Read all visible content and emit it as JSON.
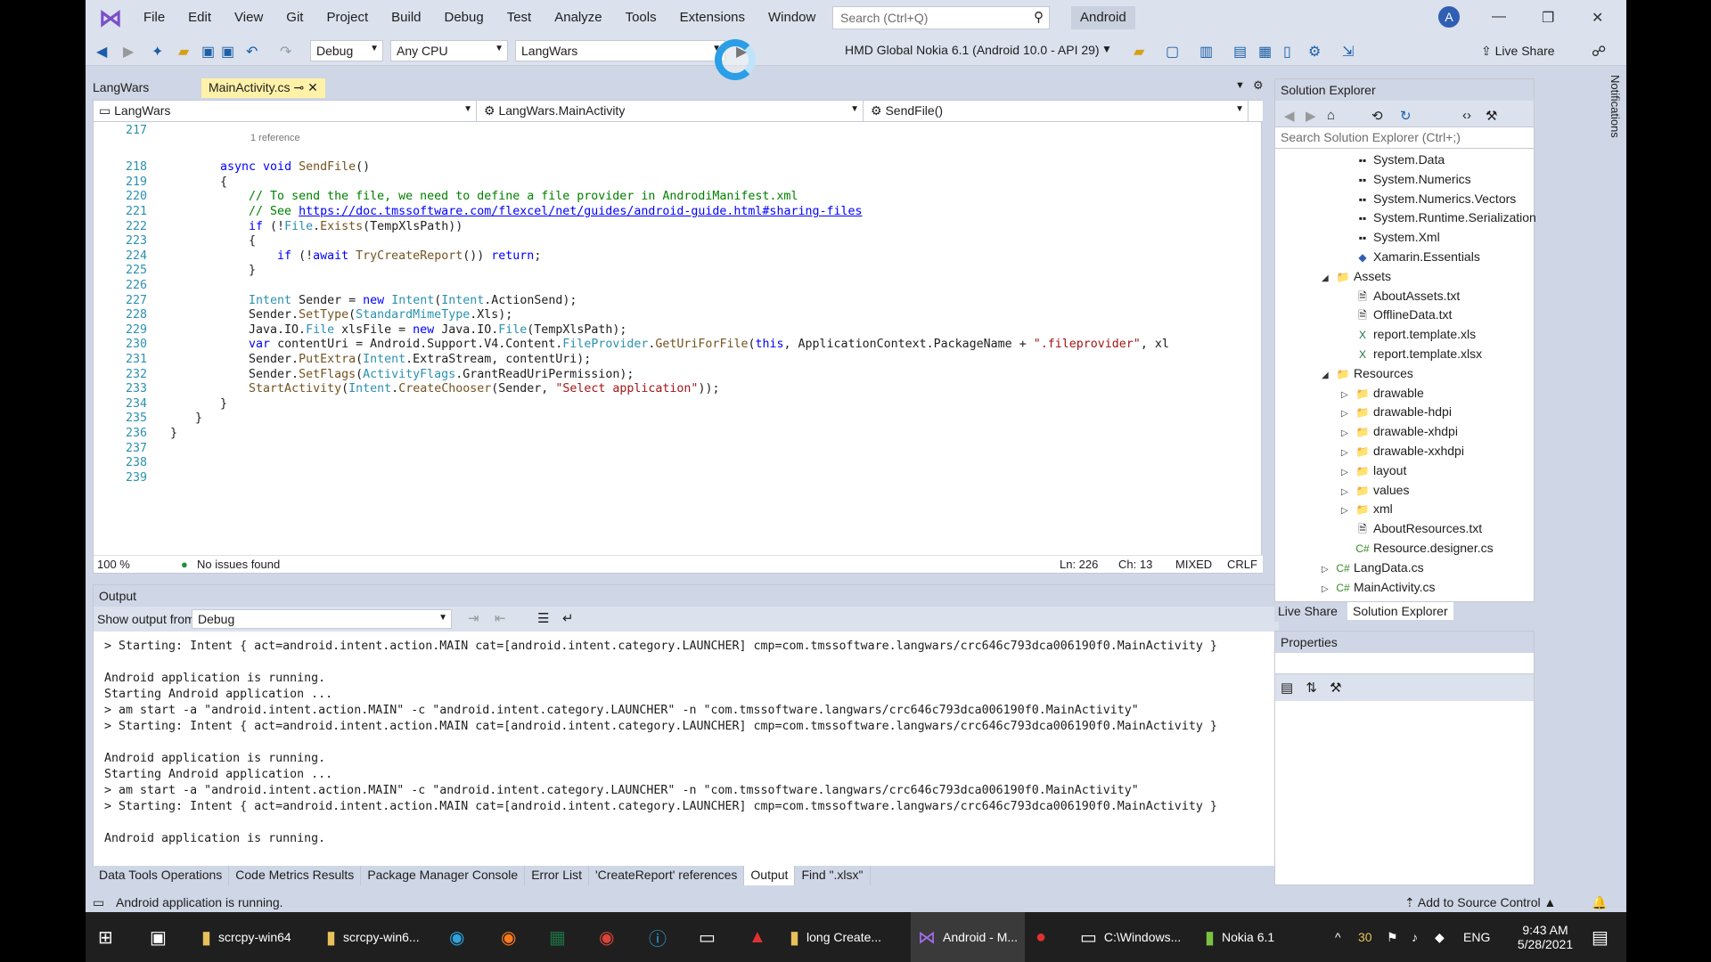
{
  "menu": [
    "File",
    "Edit",
    "View",
    "Git",
    "Project",
    "Build",
    "Debug",
    "Test",
    "Analyze",
    "Tools",
    "Extensions",
    "Window",
    "Help"
  ],
  "search_placeholder": "Search (Ctrl+Q)",
  "solution_name": "Android",
  "avatar_initial": "A",
  "toolbar": {
    "config": "Debug",
    "platform": "Any CPU",
    "project": "LangWars",
    "run_target": "HMD Global Nokia 6.1 (Android 10.0 - API 29)",
    "live_share": "Live Share"
  },
  "doc_tabs": [
    {
      "label": "LangWars"
    },
    {
      "label": "MainActivity.cs"
    }
  ],
  "nav": {
    "project": "LangWars",
    "class": "LangWars.MainActivity",
    "member": "SendFile()"
  },
  "ref_hint": "1 reference",
  "code_lines": [
    {
      "n": "217",
      "html": ""
    },
    {
      "n": "218",
      "html": "<span class='kw'>async</span> <span class='kw'>void</span> <span class='mt'>SendFile</span>()"
    },
    {
      "n": "219",
      "html": "{"
    },
    {
      "n": "220",
      "html": "    <span class='cm'>// To send the file, we need to define a file provider in AndrodiManifest.xml</span>"
    },
    {
      "n": "221",
      "html": "    <span class='cm'>// See </span><span class='lk'>https://doc.tmssoftware.com/flexcel/net/guides/android-guide.html#sharing-files</span>"
    },
    {
      "n": "222",
      "html": "    <span class='kw'>if</span> (!<span class='ty'>File</span>.<span class='mt'>Exists</span>(TempXlsPath))"
    },
    {
      "n": "223",
      "html": "    {"
    },
    {
      "n": "224",
      "html": "        <span class='kw'>if</span> (!<span class='kw'>await</span> <span class='mt'>TryCreateReport</span>()) <span class='kw'>return</span>;"
    },
    {
      "n": "225",
      "html": "    }"
    },
    {
      "n": "226",
      "html": ""
    },
    {
      "n": "227",
      "html": "    <span class='ty'>Intent</span> Sender = <span class='kw'>new</span> <span class='ty'>Intent</span>(<span class='ty'>Intent</span>.ActionSend);"
    },
    {
      "n": "228",
      "html": "    Sender.<span class='mt'>SetType</span>(<span class='ty'>StandardMimeType</span>.Xls);"
    },
    {
      "n": "229",
      "html": "    Java.IO.<span class='ty'>File</span> xlsFile = <span class='kw'>new</span> Java.IO.<span class='ty'>File</span>(TempXlsPath);"
    },
    {
      "n": "230",
      "html": "    <span class='kw'>var</span> contentUri = Android.Support.V4.Content.<span class='ty'>FileProvider</span>.<span class='mt'>GetUriForFile</span>(<span class='kw'>this</span>, ApplicationContext.PackageName + <span class='st'>\".fileprovider\"</span>, xl"
    },
    {
      "n": "231",
      "html": "    Sender.<span class='mt'>PutExtra</span>(<span class='ty'>Intent</span>.ExtraStream, contentUri);"
    },
    {
      "n": "232",
      "html": "    Sender.<span class='mt'>SetFlags</span>(<span class='ty'>ActivityFlags</span>.GrantReadUriPermission);"
    },
    {
      "n": "233",
      "html": "    <span class='mt'>StartActivity</span>(<span class='ty'>Intent</span>.<span class='mt'>CreateChooser</span>(Sender, <span class='st'>\"Select application\"</span>));"
    },
    {
      "n": "234",
      "html": "}"
    },
    {
      "n": "235",
      "html": "}"
    },
    {
      "n": "236",
      "html": "}"
    },
    {
      "n": "237",
      "html": ""
    },
    {
      "n": "238",
      "html": ""
    },
    {
      "n": "239",
      "html": ""
    }
  ],
  "editor_status": {
    "zoom": "100 %",
    "issues": "No issues found",
    "ln": "Ln: 226",
    "ch": "Ch: 13",
    "mode": "MIXED",
    "eol": "CRLF"
  },
  "output": {
    "title": "Output",
    "show_from_label": "Show output from:",
    "show_from_value": "Debug",
    "lines": [
      "> Starting: Intent { act=android.intent.action.MAIN cat=[android.intent.category.LAUNCHER] cmp=com.tmssoftware.langwars/crc646c793dca006190f0.MainActivity }",
      "",
      "Android application is running.",
      "Starting Android application ...",
      "> am start -a \"android.intent.action.MAIN\" -c \"android.intent.category.LAUNCHER\" -n \"com.tmssoftware.langwars/crc646c793dca006190f0.MainActivity\"",
      "> Starting: Intent { act=android.intent.action.MAIN cat=[android.intent.category.LAUNCHER] cmp=com.tmssoftware.langwars/crc646c793dca006190f0.MainActivity }",
      "",
      "Android application is running.",
      "Starting Android application ...",
      "> am start -a \"android.intent.action.MAIN\" -c \"android.intent.category.LAUNCHER\" -n \"com.tmssoftware.langwars/crc646c793dca006190f0.MainActivity\"",
      "> Starting: Intent { act=android.intent.action.MAIN cat=[android.intent.category.LAUNCHER] cmp=com.tmssoftware.langwars/crc646c793dca006190f0.MainActivity }",
      "",
      "Android application is running."
    ]
  },
  "bottom_tabs": [
    "Data Tools Operations",
    "Code Metrics Results",
    "Package Manager Console",
    "Error List",
    "'CreateReport' references",
    "Output",
    "Find \".xlsx\""
  ],
  "solution_explorer": {
    "title": "Solution Explorer",
    "search_placeholder": "Search Solution Explorer (Ctrl+;)",
    "nodes": [
      {
        "label": "System.Data",
        "icon": "▪▪",
        "indent": 2,
        "arrow": ""
      },
      {
        "label": "System.Numerics",
        "icon": "▪▪",
        "indent": 2,
        "arrow": ""
      },
      {
        "label": "System.Numerics.Vectors",
        "icon": "▪▪",
        "indent": 2,
        "arrow": ""
      },
      {
        "label": "System.Runtime.Serialization",
        "icon": "▪▪",
        "indent": 2,
        "arrow": ""
      },
      {
        "label": "System.Xml",
        "icon": "▪▪",
        "indent": 2,
        "arrow": ""
      },
      {
        "label": "Xamarin.Essentials",
        "icon": "◆",
        "indent": 2,
        "arrow": ""
      },
      {
        "label": "Assets",
        "icon": "📁",
        "indent": 1,
        "arrow": "◢"
      },
      {
        "label": "AboutAssets.txt",
        "icon": "🗎",
        "indent": 2,
        "arrow": ""
      },
      {
        "label": "OfflineData.txt",
        "icon": "🗎",
        "indent": 2,
        "arrow": ""
      },
      {
        "label": "report.template.xls",
        "icon": "X",
        "indent": 2,
        "arrow": ""
      },
      {
        "label": "report.template.xlsx",
        "icon": "X",
        "indent": 2,
        "arrow": ""
      },
      {
        "label": "Resources",
        "icon": "📁",
        "indent": 1,
        "arrow": "◢"
      },
      {
        "label": "drawable",
        "icon": "📁",
        "indent": 2,
        "arrow": "▷"
      },
      {
        "label": "drawable-hdpi",
        "icon": "📁",
        "indent": 2,
        "arrow": "▷"
      },
      {
        "label": "drawable-xhdpi",
        "icon": "📁",
        "indent": 2,
        "arrow": "▷"
      },
      {
        "label": "drawable-xxhdpi",
        "icon": "📁",
        "indent": 2,
        "arrow": "▷"
      },
      {
        "label": "layout",
        "icon": "📁",
        "indent": 2,
        "arrow": "▷"
      },
      {
        "label": "values",
        "icon": "📁",
        "indent": 2,
        "arrow": "▷"
      },
      {
        "label": "xml",
        "icon": "📁",
        "indent": 2,
        "arrow": "▷"
      },
      {
        "label": "AboutResources.txt",
        "icon": "🗎",
        "indent": 2,
        "arrow": ""
      },
      {
        "label": "Resource.designer.cs",
        "icon": "C#",
        "indent": 2,
        "arrow": ""
      },
      {
        "label": "LangData.cs",
        "icon": "C#",
        "indent": 1,
        "arrow": "▷"
      },
      {
        "label": "MainActivity.cs",
        "icon": "C#",
        "indent": 1,
        "arrow": "▷"
      }
    ],
    "tabs": [
      "Live Share",
      "Solution Explorer"
    ]
  },
  "properties_title": "Properties",
  "notifications_label": "Notifications",
  "status": {
    "message": "Android application is running.",
    "source_control": "Add to Source Control"
  },
  "taskbar": {
    "items": [
      "scrcpy-win64",
      "scrcpy-win6...",
      "long Create...",
      "Android - M...",
      "C:\\Windows...",
      "Nokia 6.1"
    ],
    "tray_count": "30",
    "lang": "ENG",
    "time": "9:43 AM",
    "date": "5/28/2021"
  }
}
